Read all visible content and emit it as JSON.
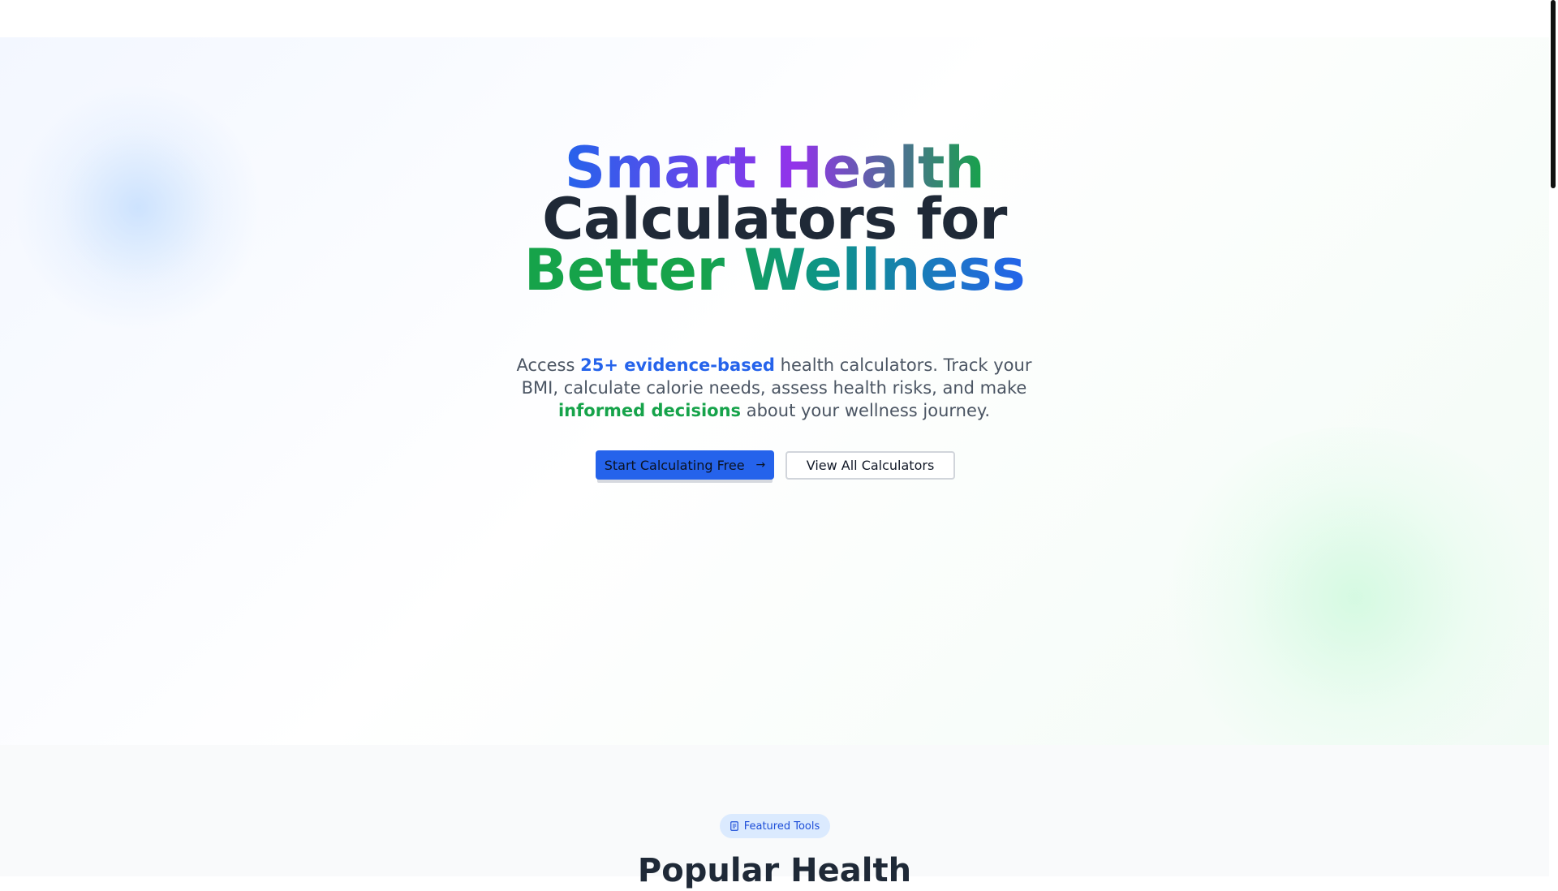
{
  "hero": {
    "title_part1": "Smart Health",
    "title_part2": "Calculators for",
    "title_part3": "Better Wellness",
    "subtitle_pre": "Access ",
    "subtitle_highlight1": "25+ evidence-based",
    "subtitle_mid": " health calculators. Track your BMI, calculate calorie needs, assess health risks, and make ",
    "subtitle_highlight2": "informed decisions",
    "subtitle_post": " about your wellness journey.",
    "primary_button": "Start Calculating Free",
    "primary_button_icon": "arrow-right-icon",
    "secondary_button": "View All Calculators"
  },
  "featured": {
    "badge_label": "Featured Tools",
    "badge_icon": "document-icon",
    "heading": "Popular Health"
  },
  "colors": {
    "brand_blue": "#2563eb",
    "brand_green": "#16a34a",
    "brand_purple": "#9333ea",
    "heading_dark": "#1f2937"
  }
}
